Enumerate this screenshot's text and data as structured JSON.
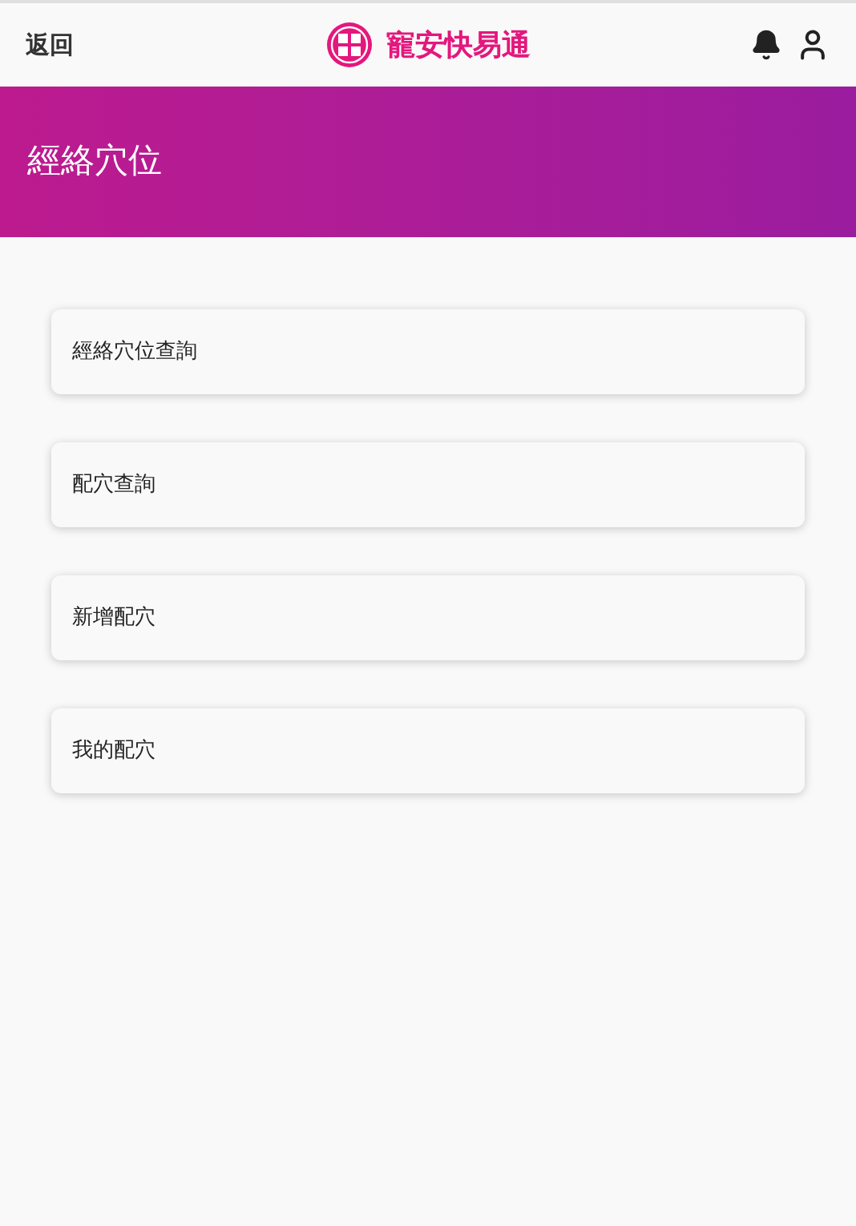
{
  "header": {
    "back": "返回",
    "brand": "寵安快易通"
  },
  "banner": {
    "title": "經絡穴位"
  },
  "menu": [
    {
      "label": "經絡穴位查詢"
    },
    {
      "label": "配穴查詢"
    },
    {
      "label": "新增配穴"
    },
    {
      "label": "我的配穴"
    }
  ]
}
